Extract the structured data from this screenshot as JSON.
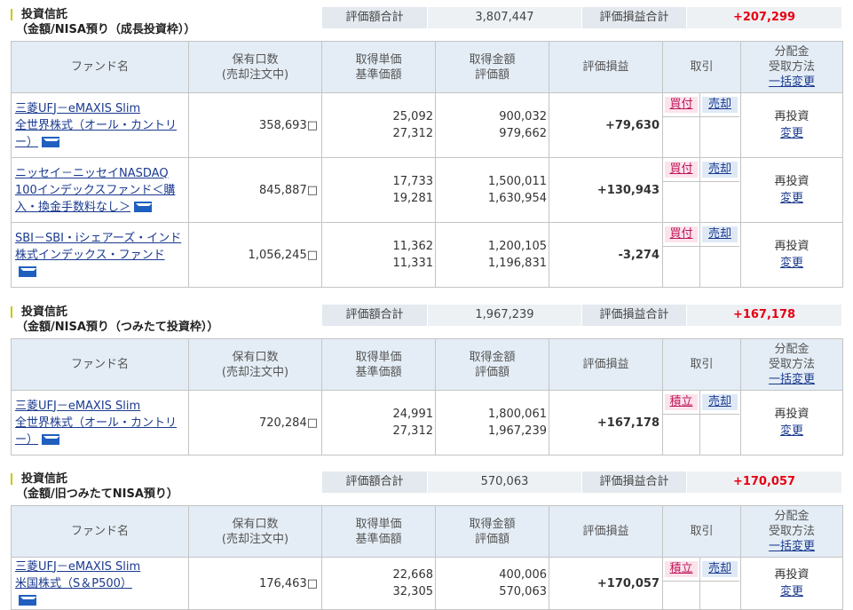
{
  "sections": [
    {
      "title_line1": "投資信託",
      "title_line2": "（金額/NISA預り（成長投資枠））",
      "summary": {
        "label_eval": "評価額合計",
        "value_eval": "3,807,447",
        "label_pl": "評価損益合計",
        "value_pl": "+207,299"
      },
      "headers": {
        "fund": "ファンド名",
        "qty1": "保有口数",
        "qty2": "(売却注文中)",
        "price1": "取得単価",
        "price2": "基準価額",
        "amt1": "取得金額",
        "amt2": "評価額",
        "pl": "評価損益",
        "trade": "取引",
        "div1": "分配金",
        "div2": "受取方法",
        "div3": "一括変更"
      },
      "rows": [
        {
          "name_lines": [
            "三菱UFJ－eMAXIS Slim",
            "全世界株式（オール・カントリ",
            "ー）"
          ],
          "qty": "358,693□",
          "cost_unit": "25,092",
          "nav": "27,312",
          "cost_amt": "900,032",
          "eval_amt": "979,662",
          "pl": "+79,630",
          "buy": "買付",
          "sell": "売却",
          "method": "再投資",
          "change": "変更"
        },
        {
          "name_lines": [
            "ニッセイ－ニッセイNASDAQ",
            "100インデックスファンド＜購",
            "入・換金手数料なし＞"
          ],
          "qty": "845,887□",
          "cost_unit": "17,733",
          "nav": "19,281",
          "cost_amt": "1,500,011",
          "eval_amt": "1,630,954",
          "pl": "+130,943",
          "buy": "買付",
          "sell": "売却",
          "method": "再投資",
          "change": "変更"
        },
        {
          "name_lines": [
            "SBI－SBI・iシェアーズ・インド",
            "株式インデックス・ファンド",
            ""
          ],
          "qty": "1,056,245□",
          "cost_unit": "11,362",
          "nav": "11,331",
          "cost_amt": "1,200,105",
          "eval_amt": "1,196,831",
          "pl": "-3,274",
          "buy": "買付",
          "sell": "売却",
          "method": "再投資",
          "change": "変更"
        }
      ]
    },
    {
      "title_line1": "投資信託",
      "title_line2": "（金額/NISA預り（つみたて投資枠））",
      "summary": {
        "label_eval": "評価額合計",
        "value_eval": "1,967,239",
        "label_pl": "評価損益合計",
        "value_pl": "+167,178"
      },
      "headers": {
        "fund": "ファンド名",
        "qty1": "保有口数",
        "qty2": "(売却注文中)",
        "price1": "取得単価",
        "price2": "基準価額",
        "amt1": "取得金額",
        "amt2": "評価額",
        "pl": "評価損益",
        "trade": "取引",
        "div1": "分配金",
        "div2": "受取方法",
        "div3": "一括変更"
      },
      "rows": [
        {
          "name_lines": [
            "三菱UFJ－eMAXIS Slim",
            "全世界株式（オール・カントリ",
            "ー）"
          ],
          "qty": "720,284□",
          "cost_unit": "24,991",
          "nav": "27,312",
          "cost_amt": "1,800,061",
          "eval_amt": "1,967,239",
          "pl": "+167,178",
          "buy": "積立",
          "sell": "売却",
          "method": "再投資",
          "change": "変更"
        }
      ]
    },
    {
      "title_line1": "投資信託",
      "title_line2": "（金額/旧つみたてNISA預り）",
      "summary": {
        "label_eval": "評価額合計",
        "value_eval": "570,063",
        "label_pl": "評価損益合計",
        "value_pl": "+170,057"
      },
      "headers": {
        "fund": "ファンド名",
        "qty1": "保有口数",
        "qty2": "(売却注文中)",
        "price1": "取得単価",
        "price2": "基準価額",
        "amt1": "取得金額",
        "amt2": "評価額",
        "pl": "評価損益",
        "trade": "取引",
        "div1": "分配金",
        "div2": "受取方法",
        "div3": "一括変更"
      },
      "rows": [
        {
          "name_lines": [
            "三菱UFJ－eMAXIS Slim",
            "米国株式（S＆P500）",
            ""
          ],
          "qty": "176,463□",
          "cost_unit": "22,668",
          "nav": "32,305",
          "cost_amt": "400,006",
          "eval_amt": "570,063",
          "pl": "+170,057",
          "buy": "積立",
          "sell": "売却",
          "method": "再投資",
          "change": "変更"
        }
      ]
    }
  ],
  "colors": {
    "positive": "#e60012",
    "negative": "#1a3abf",
    "header_bg": "#e4edf6",
    "link": "#1a3a8f"
  },
  "icons": {
    "mail": "mail-icon"
  }
}
